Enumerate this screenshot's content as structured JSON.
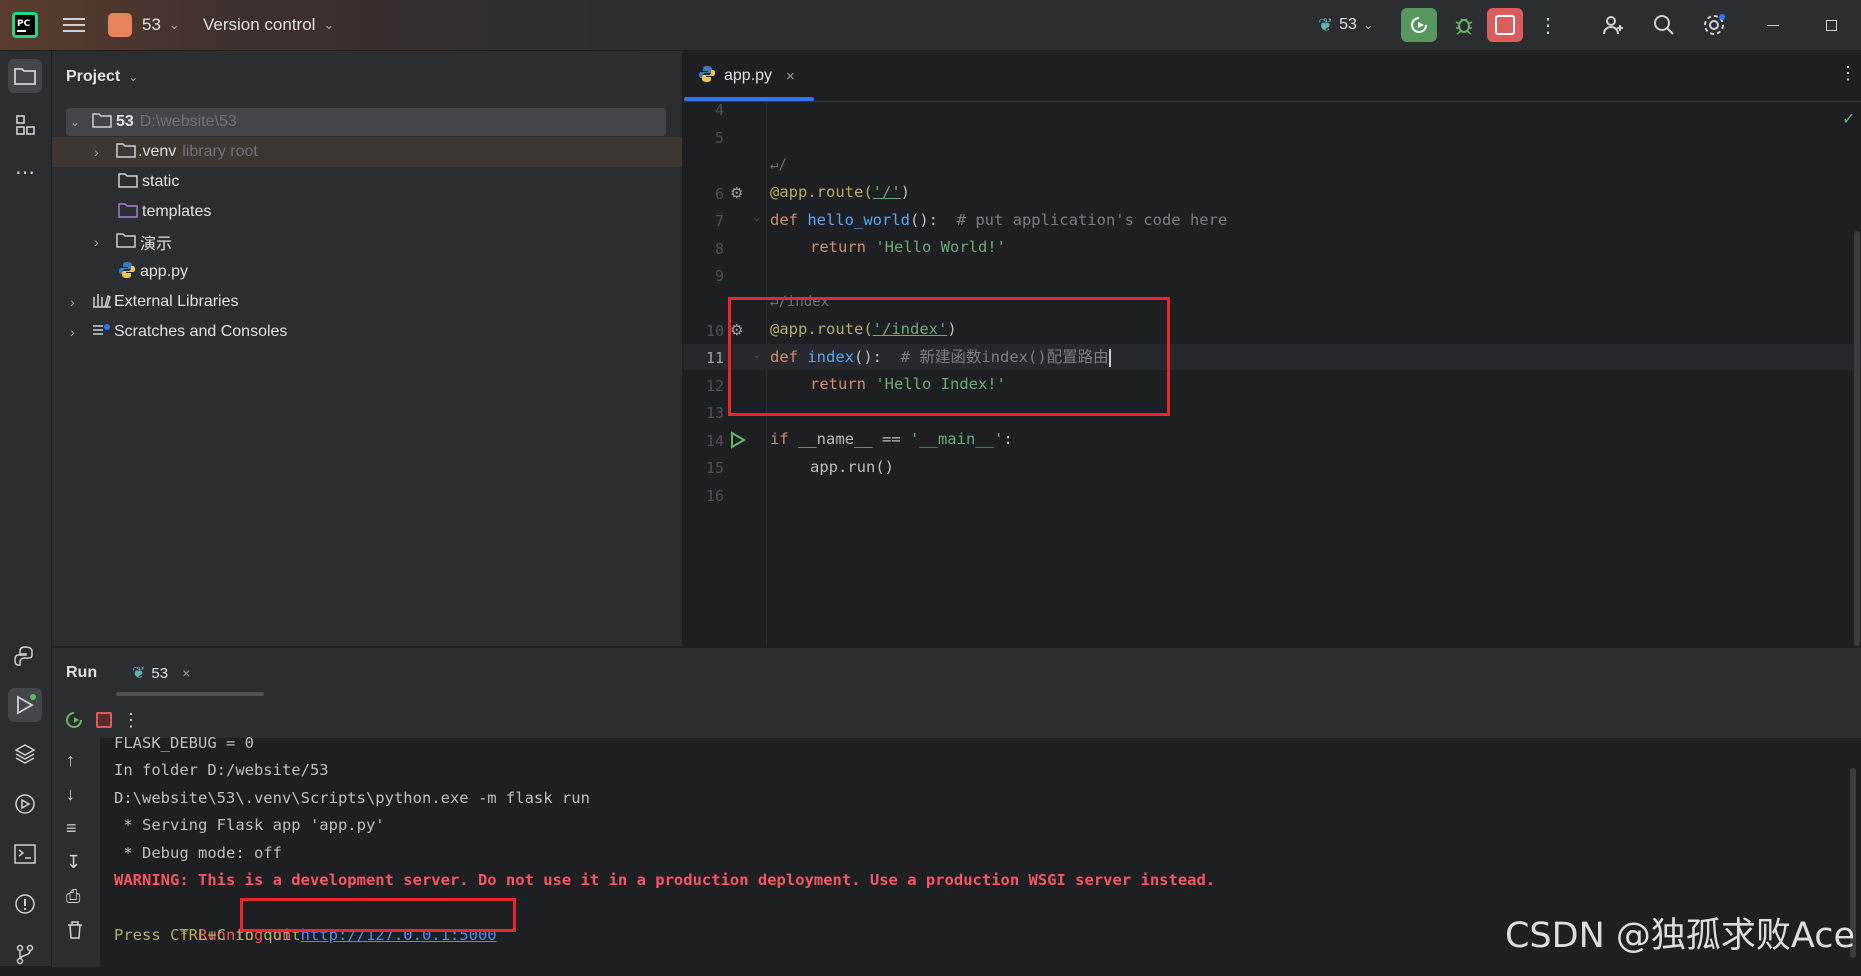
{
  "titlebar": {
    "project_badge": "53",
    "vcs_label": "Version control",
    "run_config": "53"
  },
  "project_panel": {
    "title": "Project",
    "tree": [
      {
        "name": "53",
        "hint": "D:\\website\\53"
      },
      {
        "name": ".venv",
        "hint": "library root"
      },
      {
        "name": "static",
        "hint": ""
      },
      {
        "name": "templates",
        "hint": ""
      },
      {
        "name": "演示",
        "hint": ""
      },
      {
        "name": "app.py",
        "hint": ""
      },
      {
        "name": "External Libraries",
        "hint": ""
      },
      {
        "name": "Scratches and Consoles",
        "hint": ""
      }
    ]
  },
  "editor": {
    "tab": "app.py",
    "hint_root": "/",
    "hint_index": "/index",
    "line_numbers": [
      "4",
      "5",
      "6",
      "7",
      "8",
      "9",
      "10",
      "11",
      "12",
      "13",
      "14",
      "15",
      "16"
    ],
    "code": {
      "l6_decorator": "@app.route(",
      "l6_str": "'/'",
      "l6_close": ")",
      "l7_def": "def ",
      "l7_fn": "hello_world",
      "l7_rest": "():  ",
      "l7_comment": "# put application's code here",
      "l8_return": "return ",
      "l8_str": "'Hello World!'",
      "l10_decorator": "@app.route(",
      "l10_str": "'/index'",
      "l10_close": ")",
      "l11_def": "def ",
      "l11_fn": "index",
      "l11_rest": "():  ",
      "l11_comment": "# 新建函数index()配置路由",
      "l12_return": "return ",
      "l12_str": "'Hello Index!'",
      "l14_if": "if ",
      "l14_mid": "__name__ == ",
      "l14_str": "'__main__'",
      "l14_colon": ":",
      "l15": "app.run()"
    }
  },
  "run_panel": {
    "title": "Run",
    "tab": "53",
    "console": [
      {
        "text": "FLASK_DEBUG = 0",
        "kind": "normal"
      },
      {
        "text": "In folder D:/website/53",
        "kind": "normal"
      },
      {
        "text": "D:\\website\\53\\.venv\\Scripts\\python.exe -m flask run",
        "kind": "normal"
      },
      {
        "text": " * Serving Flask app 'app.py'",
        "kind": "normal"
      },
      {
        "text": " * Debug mode: off",
        "kind": "normal"
      }
    ],
    "warning": "WARNING: This is a development server. Do not use it in a production deployment. Use a production WSGI server instead.",
    "running_prefix": " * Running on ",
    "running_url": "http://127.0.0.1:5000",
    "quit": "Press CTRL+C to quit"
  },
  "watermark": "CSDN @独孤求败Ace",
  "colors": {
    "accent": "#3574f0",
    "highlight_box": "#e8262b",
    "warning": "#f75464"
  }
}
